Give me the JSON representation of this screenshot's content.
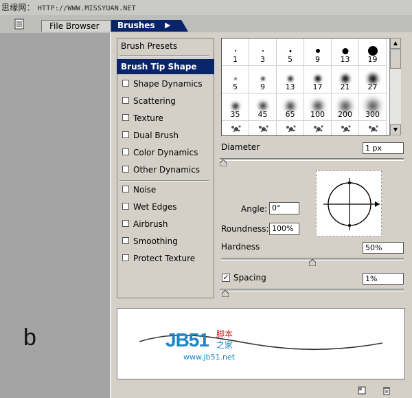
{
  "watermark": {
    "cn": "思缘网：",
    "url": "HTTP://WWW.MISSYUAN.NET"
  },
  "tabs": {
    "file_browser": "File Browser",
    "brushes": "Brushes",
    "brushes_menu_arrow": "▶"
  },
  "nav": {
    "presets": "Brush Presets",
    "tip_shape": "Brush Tip Shape",
    "group1": [
      {
        "label": "Shape Dynamics",
        "checked": false
      },
      {
        "label": "Scattering",
        "checked": false
      },
      {
        "label": "Texture",
        "checked": false
      },
      {
        "label": "Dual Brush",
        "checked": false
      },
      {
        "label": "Color Dynamics",
        "checked": false
      },
      {
        "label": "Other Dynamics",
        "checked": false
      }
    ],
    "group2": [
      {
        "label": "Noise",
        "checked": false
      },
      {
        "label": "Wet Edges",
        "checked": false
      },
      {
        "label": "Airbrush",
        "checked": false
      },
      {
        "label": "Smoothing",
        "checked": false
      },
      {
        "label": "Protect Texture",
        "checked": false
      }
    ]
  },
  "brush_grid": {
    "rows": [
      [
        "1",
        "3",
        "5",
        "9",
        "13",
        "19"
      ],
      [
        "5",
        "9",
        "13",
        "17",
        "21",
        "27"
      ],
      [
        "35",
        "45",
        "65",
        "100",
        "200",
        "300"
      ]
    ]
  },
  "controls": {
    "diameter_label": "Diameter",
    "diameter_value": "1 px",
    "diameter_level": 0.0,
    "angle_label": "Angle:",
    "angle_value": "0°",
    "roundness_label": "Roundness:",
    "roundness_value": "100%",
    "hardness_label": "Hardness",
    "hardness_value": "50%",
    "hardness_level": 0.5,
    "spacing_label": "Spacing",
    "spacing_value": "1%",
    "spacing_checked": true,
    "spacing_level": 0.01
  },
  "stroke_preview": {
    "logo_text": "JB51",
    "logo_cn_1": "脚本",
    "logo_cn_2": "之家",
    "logo_url": "www.jb51.net"
  },
  "annotation": "b",
  "colors": {
    "accent": "#0a246a",
    "panel": "#d4d0c8",
    "background": "#a4a4a4",
    "logo_blue": "#1a86c8",
    "logo_red": "#d42020"
  },
  "icons": [
    "document-icon",
    "scroll-up-icon",
    "scroll-down-icon",
    "new-brush-icon",
    "trash-icon",
    "brush-angle-icon",
    "checkbox-icon"
  ]
}
